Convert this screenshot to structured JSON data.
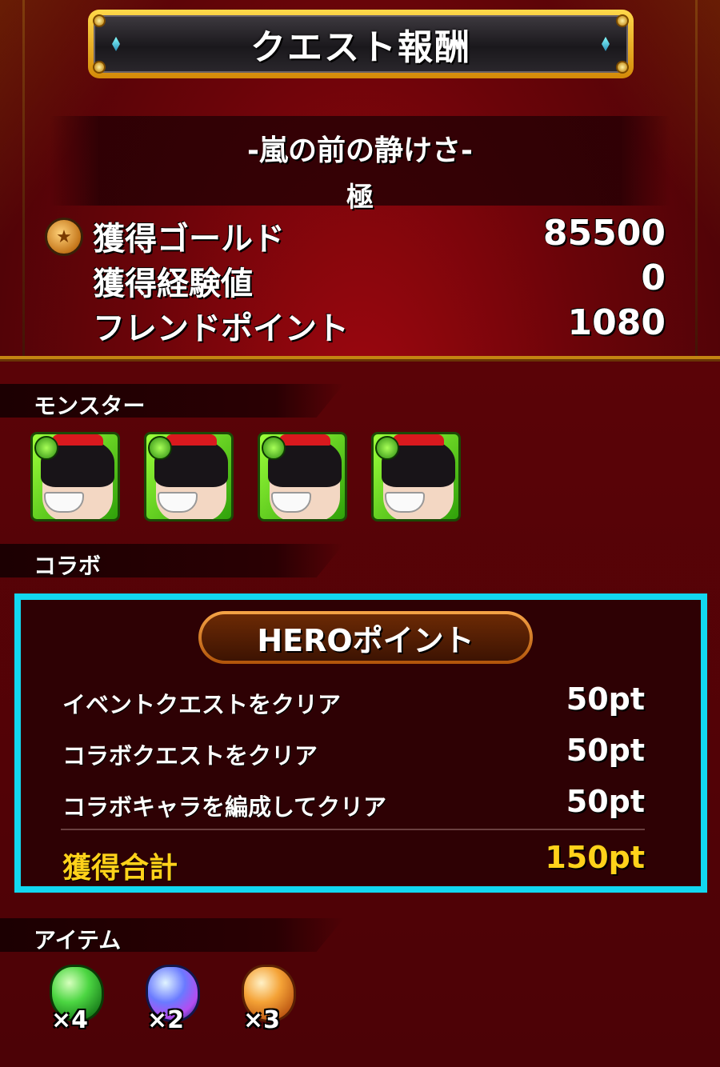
{
  "title": "クエスト報酬",
  "quest": {
    "name": "-嵐の前の静けさ-",
    "difficulty": "極"
  },
  "stats": [
    {
      "label": "獲得ゴールド",
      "value": "85500",
      "icon": "gold-coin-icon"
    },
    {
      "label": "獲得経験値",
      "value": "0"
    },
    {
      "label": "フレンドポイント",
      "value": "1080"
    }
  ],
  "sections": {
    "monster": "モンスター",
    "collab": "コラボ",
    "item": "アイテム"
  },
  "monsters": [
    {
      "icon": "monster-portrait-icon"
    },
    {
      "icon": "monster-portrait-icon"
    },
    {
      "icon": "monster-portrait-icon"
    },
    {
      "icon": "monster-portrait-icon"
    }
  ],
  "hero": {
    "title": "HEROポイント",
    "rows": [
      {
        "label": "イベントクエストをクリア",
        "value": "50pt"
      },
      {
        "label": "コラボクエストをクリア",
        "value": "50pt"
      },
      {
        "label": "コラボキャラを編成してクリア",
        "value": "50pt"
      }
    ],
    "total": {
      "label": "獲得合計",
      "value": "150pt"
    }
  },
  "items": [
    {
      "icon": "green-gem-icon",
      "count": "×4"
    },
    {
      "icon": "blue-gem-icon",
      "count": "×2"
    },
    {
      "icon": "orange-gem-icon",
      "count": "×3"
    }
  ],
  "colors": {
    "highlight_border": "#12d8f0",
    "total_text": "#ffd21a",
    "background": "#6a0409",
    "gold_frame": "#ffd84a"
  }
}
